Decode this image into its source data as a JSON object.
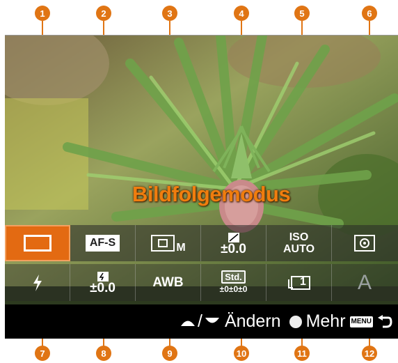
{
  "callouts_top": [
    "1",
    "2",
    "3",
    "4",
    "5",
    "6"
  ],
  "callouts_bottom": [
    "7",
    "8",
    "9",
    "10",
    "11",
    "12"
  ],
  "screen": {
    "mode_title": "Bildfolgemodus",
    "row1": {
      "af": "AF-S",
      "focus_suffix": "M",
      "exposure_value": "±0.0",
      "iso_top": "ISO",
      "iso_bottom": "AUTO"
    },
    "row2": {
      "flash_comp_value": "±0.0",
      "white_balance": "AWB",
      "creative_style_box": "Std.",
      "creative_style_values": "±0±0±0",
      "drive_count": "1",
      "auto_mode": "A"
    },
    "help": {
      "action_label": "Ändern",
      "more_label": "Mehr",
      "menu_chip": "MENU"
    }
  },
  "colors": {
    "accent": "#e07514",
    "selection": "#e36a12"
  }
}
